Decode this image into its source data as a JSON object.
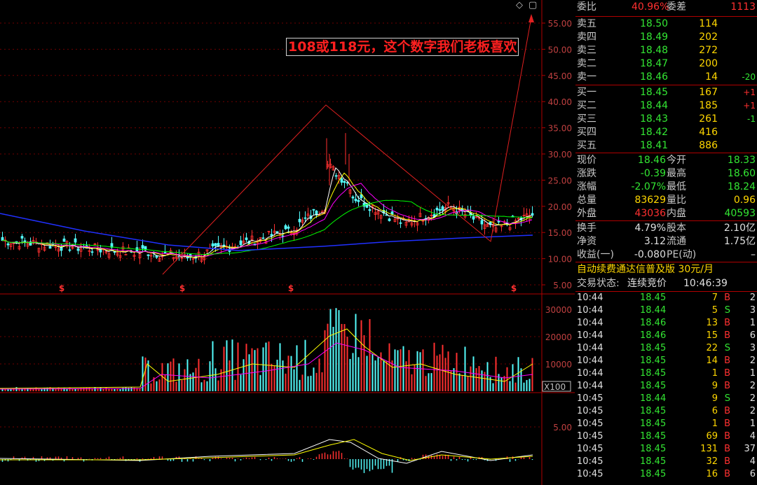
{
  "header": {
    "diamond_icon": "◇",
    "window_icon": "▢"
  },
  "annotation": {
    "text": "108或118元，这个数字我们老板喜欢"
  },
  "price_axis": {
    "ticks": [
      "55.00",
      "50.00",
      "45.00",
      "40.00",
      "35.00",
      "30.00",
      "25.00",
      "20.00",
      "15.00",
      "10.00",
      "5.00"
    ]
  },
  "volume_axis": {
    "ticks": [
      "30000",
      "20000",
      "10000"
    ],
    "multiplier": "X100"
  },
  "macd_axis": {
    "ticks": [
      "5.00"
    ]
  },
  "dividend_marks": [
    "$",
    "$",
    "$",
    "$"
  ],
  "commission": {
    "ratio_label": "委比",
    "ratio": "40.96%",
    "diff_label": "委差",
    "diff": "1113"
  },
  "asks": [
    {
      "label": "卖五",
      "price": "18.50",
      "volume": "114",
      "change": ""
    },
    {
      "label": "卖四",
      "price": "18.49",
      "volume": "202",
      "change": ""
    },
    {
      "label": "卖三",
      "price": "18.48",
      "volume": "272",
      "change": ""
    },
    {
      "label": "卖二",
      "price": "18.47",
      "volume": "200",
      "change": ""
    },
    {
      "label": "卖一",
      "price": "18.46",
      "volume": "14",
      "change": "-20"
    }
  ],
  "bids": [
    {
      "label": "买一",
      "price": "18.45",
      "volume": "167",
      "change": "+1"
    },
    {
      "label": "买二",
      "price": "18.44",
      "volume": "185",
      "change": "+1"
    },
    {
      "label": "买三",
      "price": "18.43",
      "volume": "261",
      "change": "-1"
    },
    {
      "label": "买四",
      "price": "18.42",
      "volume": "416",
      "change": ""
    },
    {
      "label": "买五",
      "price": "18.41",
      "volume": "886",
      "change": ""
    }
  ],
  "quote": [
    {
      "l1": "现价",
      "v1": "18.46",
      "c1": "green",
      "l2": "今开",
      "v2": "18.33",
      "c2": "green"
    },
    {
      "l1": "涨跌",
      "v1": "-0.39",
      "c1": "green",
      "l2": "最高",
      "v2": "18.60",
      "c2": "green"
    },
    {
      "l1": "涨幅",
      "v1": "-2.07%",
      "c1": "green",
      "l2": "最低",
      "v2": "18.24",
      "c2": "green"
    },
    {
      "l1": "总量",
      "v1": "83629",
      "c1": "yellow",
      "l2": "量比",
      "v2": "0.96",
      "c2": "yellow"
    },
    {
      "l1": "外盘",
      "v1": "43036",
      "c1": "red",
      "l2": "内盘",
      "v2": "40593",
      "c2": "green"
    }
  ],
  "stats": [
    {
      "l1": "换手",
      "v1": "4.79%",
      "l2": "股本",
      "v2": "2.10亿"
    },
    {
      "l1": "净资",
      "v1": "3.12",
      "l2": "流通",
      "v2": "1.75亿"
    },
    {
      "l1": "收益(一)",
      "v1": "-0.080",
      "l2": "PE(动)",
      "v2": "–"
    }
  ],
  "ad_text": "自动续费通达信普及版  30元/月",
  "trade_status": {
    "label": "交易状态:",
    "value": "连续竞价",
    "time": "10:46:39"
  },
  "trades": [
    {
      "time": "10:44",
      "price": "18.45",
      "vol": "7",
      "bs": "B",
      "n": "2"
    },
    {
      "time": "10:44",
      "price": "18.44",
      "vol": "5",
      "bs": "S",
      "n": "3"
    },
    {
      "time": "10:44",
      "price": "18.46",
      "vol": "13",
      "bs": "B",
      "n": "1"
    },
    {
      "time": "10:44",
      "price": "18.46",
      "vol": "15",
      "bs": "B",
      "n": "6"
    },
    {
      "time": "10:44",
      "price": "18.45",
      "vol": "22",
      "bs": "S",
      "n": "3"
    },
    {
      "time": "10:44",
      "price": "18.45",
      "vol": "14",
      "bs": "B",
      "n": "2"
    },
    {
      "time": "10:44",
      "price": "18.45",
      "vol": "1",
      "bs": "B",
      "n": "1"
    },
    {
      "time": "10:44",
      "price": "18.45",
      "vol": "9",
      "bs": "B",
      "n": "2"
    },
    {
      "time": "10:45",
      "price": "18.44",
      "vol": "9",
      "bs": "S",
      "n": "2"
    },
    {
      "time": "10:45",
      "price": "18.45",
      "vol": "6",
      "bs": "B",
      "n": "2"
    },
    {
      "time": "10:45",
      "price": "18.45",
      "vol": "1",
      "bs": "B",
      "n": "1"
    },
    {
      "time": "10:45",
      "price": "18.45",
      "vol": "69",
      "bs": "B",
      "n": "4"
    },
    {
      "time": "10:45",
      "price": "18.45",
      "vol": "131",
      "bs": "B",
      "n": "37"
    },
    {
      "time": "10:45",
      "price": "18.45",
      "vol": "32",
      "bs": "B",
      "n": "4"
    },
    {
      "time": "10:45",
      "price": "18.45",
      "vol": "16",
      "bs": "B",
      "n": "6"
    }
  ],
  "colors": {
    "up": "#ff3030",
    "down": "#33e633",
    "grid": "#800000",
    "accent": "#ffd700"
  }
}
